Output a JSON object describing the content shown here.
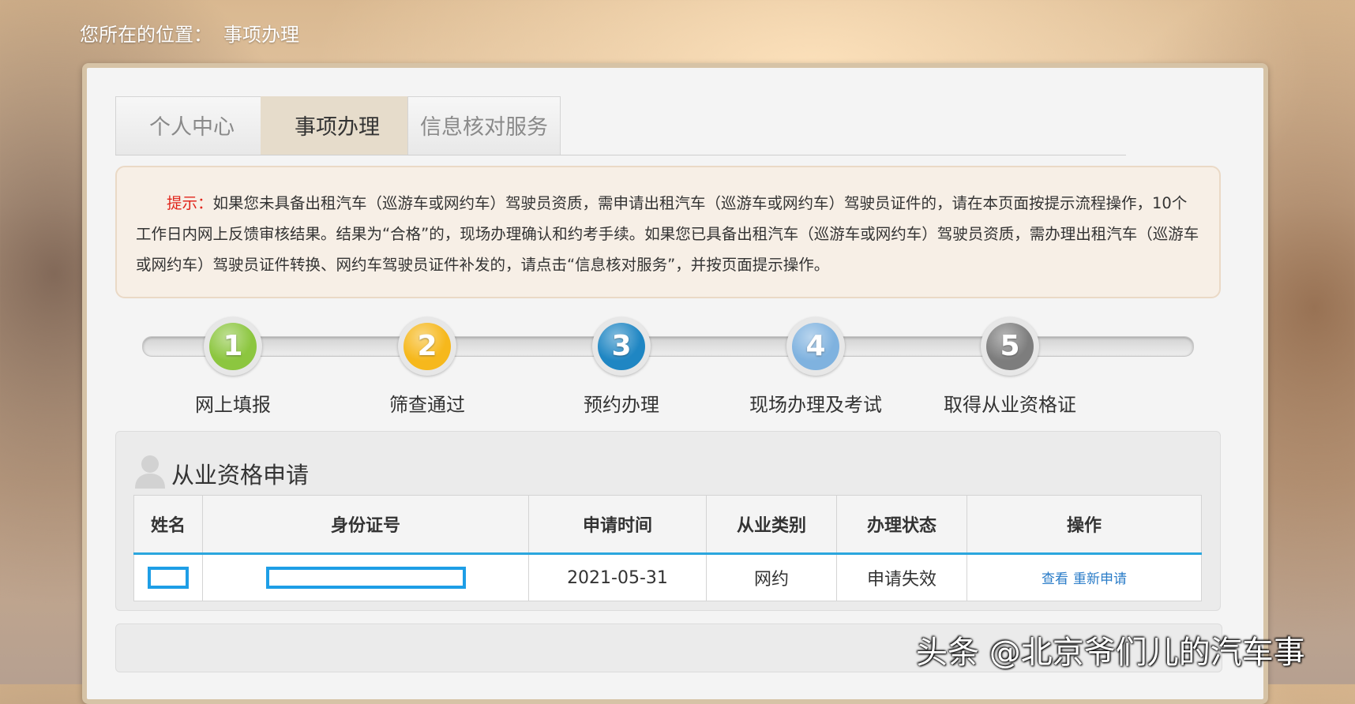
{
  "breadcrumb": {
    "prefix": "您所在的位置：",
    "current": "事项办理"
  },
  "tabs": [
    {
      "label": "个人中心",
      "active": false
    },
    {
      "label": "事项办理",
      "active": true
    },
    {
      "label": "信息核对服务",
      "active": false
    }
  ],
  "notice": {
    "label": "提示：",
    "text": "如果您未具备出租汽车（巡游车或网约车）驾驶员资质，需申请出租汽车（巡游车或网约车）驾驶员证件的，请在本页面按提示流程操作，10个工作日内网上反馈审核结果。结果为“合格”的，现场办理确认和约考手续。如果您已具备出租汽车（巡游车或网约车）驾驶员资质，需办理出租汽车（巡游车或网约车）驾驶员证件转换、网约车驾驶员证件补发的，请点击“信息核对服务”，并按页面提示操作。"
  },
  "steps": [
    {
      "number": "1",
      "label": "网上填报",
      "color": "#8cc63f"
    },
    {
      "number": "2",
      "label": "筛查通过",
      "color": "#f6b81c"
    },
    {
      "number": "3",
      "label": "预约办理",
      "color": "#1f86c3"
    },
    {
      "number": "4",
      "label": "现场办理及考试",
      "color": "#7fb2df"
    },
    {
      "number": "5",
      "label": "取得从业资格证",
      "color": "#7d7d7d"
    }
  ],
  "section": {
    "title": "从业资格申请"
  },
  "table": {
    "headers": [
      "姓名",
      "身份证号",
      "申请时间",
      "从业类别",
      "办理状态",
      "操作"
    ],
    "rows": [
      {
        "name": "",
        "id_number": "",
        "apply_time": "2021-05-31",
        "category": "网约",
        "status": "申请失效",
        "actions": [
          "查看",
          "重新申请"
        ]
      }
    ]
  },
  "watermark": "头条 @北京爷们儿的汽车事"
}
